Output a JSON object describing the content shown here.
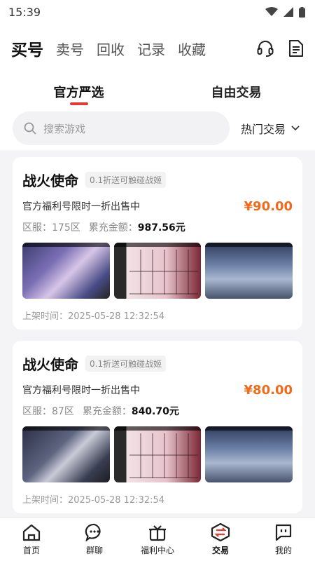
{
  "status_bar": {
    "time": "15:39"
  },
  "header": {
    "tabs": [
      {
        "label": "买号",
        "active": true
      },
      {
        "label": "卖号",
        "active": false
      },
      {
        "label": "回收",
        "active": false
      },
      {
        "label": "记录",
        "active": false
      },
      {
        "label": "收藏",
        "active": false
      }
    ],
    "icons": [
      "headset-icon",
      "document-icon"
    ]
  },
  "sub_tabs": [
    {
      "label": "官方严选",
      "active": true
    },
    {
      "label": "自由交易",
      "active": false
    }
  ],
  "search": {
    "placeholder": "搜索游戏",
    "sort_label": "热门交易"
  },
  "listings": [
    {
      "title": "战火使命",
      "tag": "0.1折送可触碰战姬",
      "desc": "官方福利号限时一折出售中",
      "price": "¥90.00",
      "server": "区服：175区",
      "recharge_label": "累充金额：",
      "recharge_amount": "987.56元",
      "time": "上架时间：2025-05-28 12:32:54"
    },
    {
      "title": "战火使命",
      "tag": "0.1折送可触碰战姬",
      "desc": "官方福利号限时一折出售中",
      "price": "¥80.00",
      "server": "区服：87区",
      "recharge_label": "累充金额：",
      "recharge_amount": "840.70元",
      "time": "上架时间：2025-05-28 12:32:54"
    }
  ],
  "bottom_nav": [
    {
      "label": "首页",
      "icon": "home-icon"
    },
    {
      "label": "群聊",
      "icon": "chat-icon"
    },
    {
      "label": "福利中心",
      "icon": "gift-icon"
    },
    {
      "label": "交易",
      "icon": "trade-icon",
      "active": true
    },
    {
      "label": "我的",
      "icon": "profile-icon"
    }
  ],
  "colors": {
    "accent_red": "#e83a33",
    "price_orange": "#ef6b1b"
  }
}
